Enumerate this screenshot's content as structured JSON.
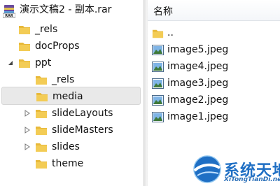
{
  "archive": {
    "title": "演示文稿2 - 副本.rar",
    "icon": "rar-archive-icon"
  },
  "tree": [
    {
      "label": "_rels",
      "expandable": false
    },
    {
      "label": "docProps",
      "expandable": false
    },
    {
      "label": "ppt",
      "expanded": true
    },
    {
      "label": "_rels",
      "expandable": false
    },
    {
      "label": "media",
      "selected": true
    },
    {
      "label": "slideLayouts",
      "expandable": true
    },
    {
      "label": "slideMasters",
      "expandable": true
    },
    {
      "label": "slides",
      "expandable": true
    },
    {
      "label": "theme",
      "expandable": false
    }
  ],
  "list": {
    "column_header": "名称",
    "items": [
      {
        "label": "..",
        "icon": "folder-icon"
      },
      {
        "label": "image5.jpeg",
        "icon": "image-file-icon"
      },
      {
        "label": "image4.jpeg",
        "icon": "image-file-icon"
      },
      {
        "label": "image3.jpeg",
        "icon": "image-file-icon"
      },
      {
        "label": "image2.jpeg",
        "icon": "image-file-icon"
      },
      {
        "label": "image1.jpeg",
        "icon": "image-file-icon"
      }
    ]
  },
  "watermark": {
    "title": "系统天地",
    "subtitle": "XiTongTianDi.net"
  },
  "colors": {
    "folder": "#e8b93a",
    "selection": "#e9e9e9",
    "watermark": "#1f6fc4"
  }
}
